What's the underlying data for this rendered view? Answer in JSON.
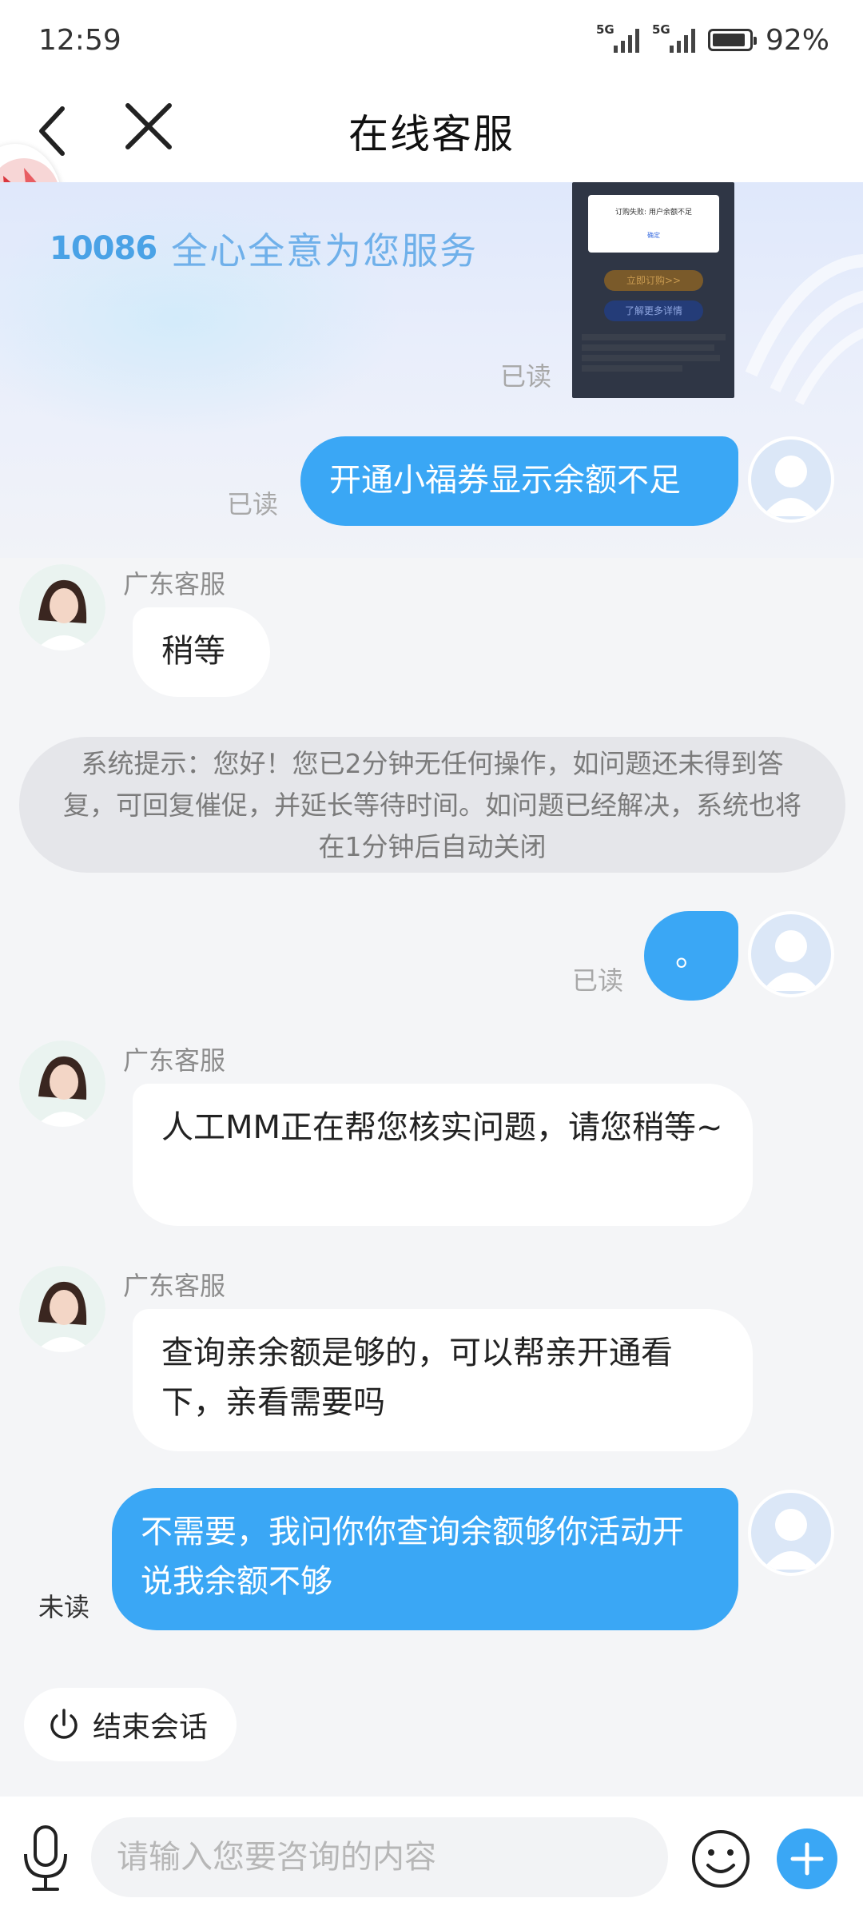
{
  "status_bar": {
    "time": "12:59",
    "battery": "92%",
    "network": [
      "5G",
      "5G"
    ]
  },
  "header": {
    "title": "在线客服"
  },
  "banner": {
    "brand_number": "10086",
    "slogan": "全心全意为您服务"
  },
  "screenshot_thumb": {
    "dialog_text": "订购失败: 用户余额不足",
    "dialog_ok": "确定",
    "button1": "立即订购>>",
    "button2": "了解更多详情"
  },
  "messages": [
    {
      "type": "image",
      "status": "已读"
    },
    {
      "type": "out",
      "text": "开通小福券显示余额不足",
      "status": "已读"
    },
    {
      "type": "in",
      "agent": "广东客服",
      "text": "稍等"
    },
    {
      "type": "system",
      "text": "系统提示：您好！您已2分钟无任何操作，如问题还未得到答复，可回复催促，并延长等待时间。如问题已经解决，系统也将在1分钟后自动关闭"
    },
    {
      "type": "out",
      "text": "。",
      "status": "已读"
    },
    {
      "type": "in",
      "agent": "广东客服",
      "text": "人工MM正在帮您核实问题，请您稍等~"
    },
    {
      "type": "in",
      "agent": "广东客服",
      "text": "查询亲余额是够的，可以帮亲开通看下，亲看需要吗"
    },
    {
      "type": "out",
      "text": "不需要，我问你你查询余额够你活动开说我余额不够",
      "status": "未读"
    }
  ],
  "end_session": {
    "label": "结束会话"
  },
  "input": {
    "placeholder": "请输入您要咨询的内容"
  },
  "colors": {
    "accent": "#3aa7f5",
    "header_bg": "#ffffff",
    "page_bg": "#f4f5f7"
  }
}
